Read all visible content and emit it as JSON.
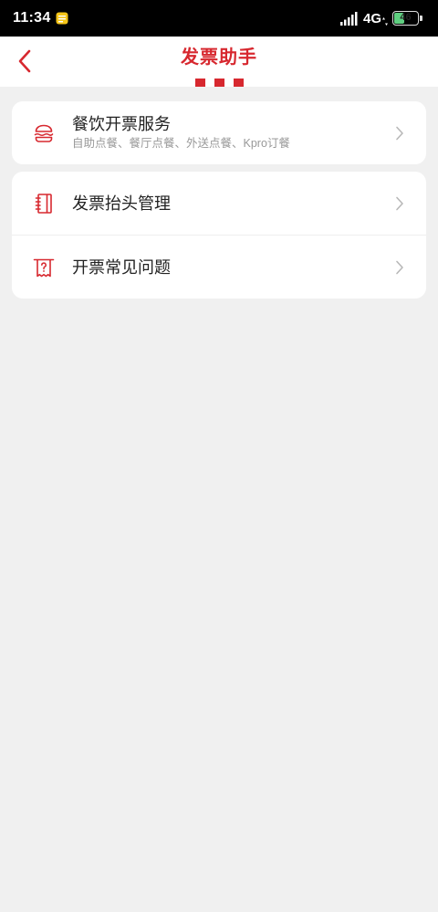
{
  "status_bar": {
    "time": "11:34",
    "notification_icon": "note-app-icon",
    "signal_icon": "cellular-signal-icon",
    "network": "4G",
    "data_icon": "data-arrows-icon",
    "battery_icon": "battery-icon",
    "battery_level": "46",
    "battery_percent": 46
  },
  "header": {
    "back_icon": "chevron-left-icon",
    "title": "发票助手",
    "logo_icon": "kfc-stripes-icon"
  },
  "services": [
    {
      "title": "餐饮开票服务",
      "subtitle": "自助点餐、餐厅点餐、外送点餐、Kpro订餐",
      "icon": "burger-icon",
      "chevron_icon": "chevron-right-icon"
    }
  ],
  "menu": [
    {
      "label": "发票抬头管理",
      "icon": "notebook-icon",
      "chevron_icon": "chevron-right-icon"
    },
    {
      "label": "开票常见问题",
      "icon": "receipt-question-icon",
      "chevron_icon": "chevron-right-icon"
    }
  ],
  "colors": {
    "accent": "#d7282f",
    "page_background": "#f0f0f0",
    "card_background": "#ffffff",
    "title_text": "#222222",
    "subtitle_text": "#999999",
    "chevron": "#b8b8b8",
    "status_bar": "#000000",
    "battery_fill": "#5fcf80"
  }
}
